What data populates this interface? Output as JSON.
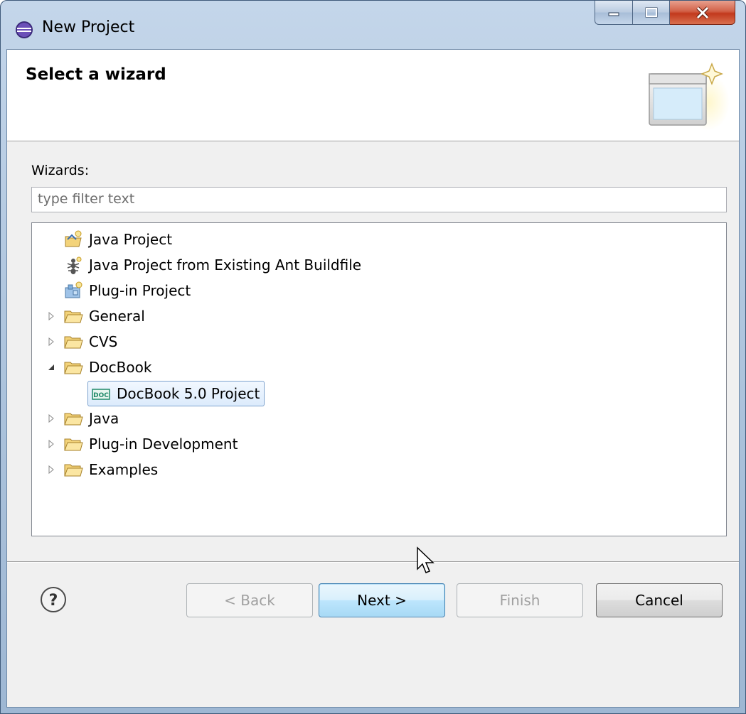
{
  "window": {
    "title": "New Project"
  },
  "header": {
    "title": "Select a wizard"
  },
  "wizards": {
    "label": "Wizards:",
    "filter_placeholder": "type filter text"
  },
  "tree": {
    "items": [
      {
        "label": "Java Project",
        "icon": "java-project-icon",
        "expandable": false
      },
      {
        "label": "Java Project from Existing Ant Buildfile",
        "icon": "ant-icon",
        "expandable": false
      },
      {
        "label": "Plug-in Project",
        "icon": "plugin-project-icon",
        "expandable": false
      },
      {
        "label": "General",
        "icon": "folder-icon",
        "expandable": true,
        "expanded": false
      },
      {
        "label": "CVS",
        "icon": "folder-icon",
        "expandable": true,
        "expanded": false
      },
      {
        "label": "DocBook",
        "icon": "folder-icon",
        "expandable": true,
        "expanded": true
      },
      {
        "label": "DocBook 5.0 Project",
        "icon": "docbook-doc-icon",
        "expandable": false,
        "selected": true
      },
      {
        "label": "Java",
        "icon": "folder-icon",
        "expandable": true,
        "expanded": false
      },
      {
        "label": "Plug-in Development",
        "icon": "folder-icon",
        "expandable": true,
        "expanded": false
      },
      {
        "label": "Examples",
        "icon": "folder-icon",
        "expandable": true,
        "expanded": false
      }
    ]
  },
  "buttons": {
    "back": "< Back",
    "next": "Next >",
    "finish": "Finish",
    "cancel": "Cancel"
  },
  "colors": {
    "folder": "#e8c56a",
    "selection_border": "#7da2ce",
    "default_button_border": "#3c7fb1"
  }
}
